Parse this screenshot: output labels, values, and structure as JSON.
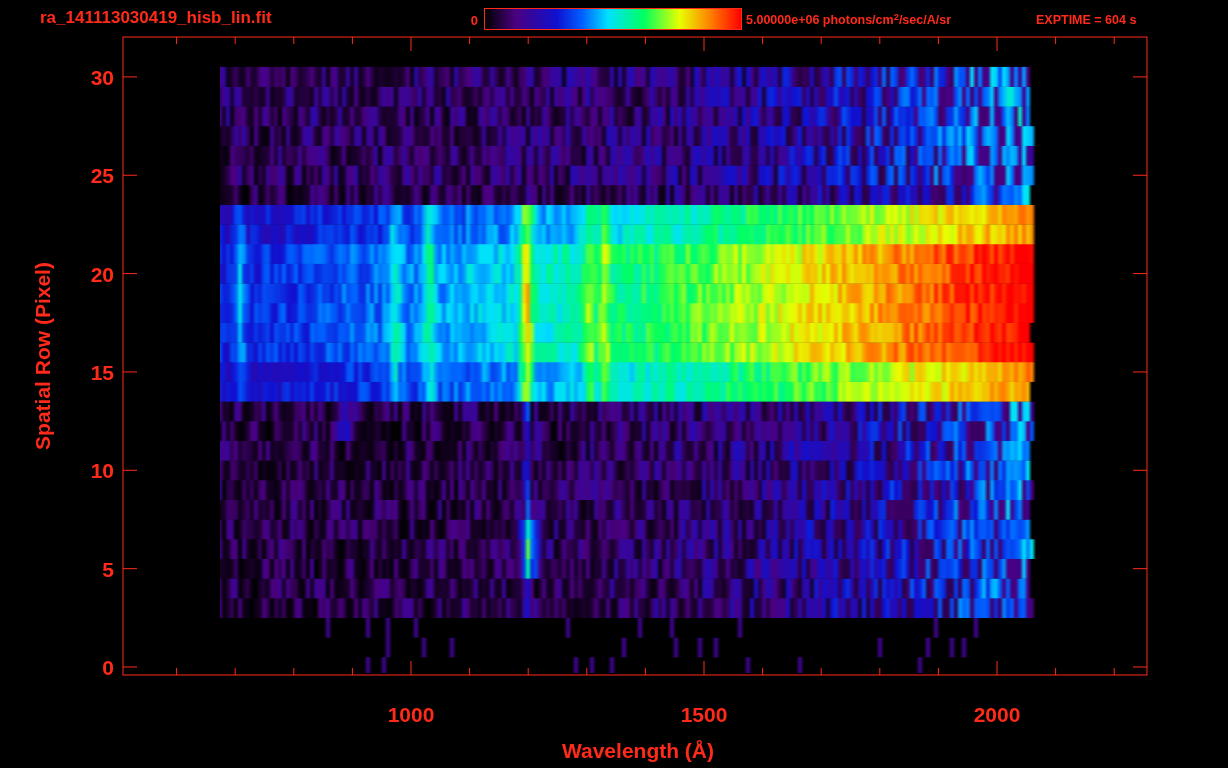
{
  "title": "ra_141113030419_hisb_lin.fit",
  "colorbar": {
    "min_label": "0",
    "max_label": "5.00000e+06 photons/cm$^{2}$/sec/A/sr"
  },
  "exptime": "EXPTIME = 604 s",
  "plot": {
    "xlabel": "Wavelength (Å)",
    "ylabel": "Spatial Row (Pixel)",
    "xtick_labels": [
      "1000",
      "1500",
      "2000"
    ],
    "ytick_labels": [
      "30",
      "25",
      "20",
      "15",
      "10",
      "5",
      "0"
    ]
  }
}
